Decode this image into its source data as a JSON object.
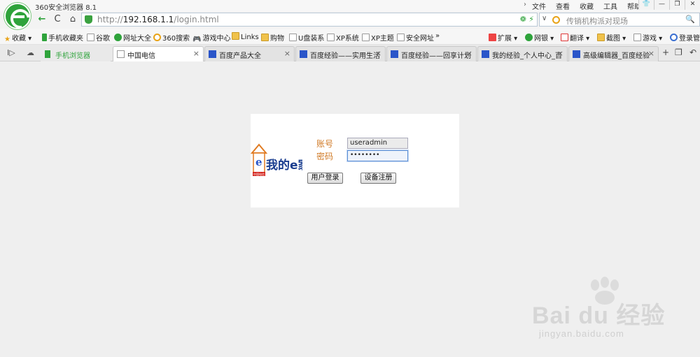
{
  "window": {
    "title": "360安全浏览器 8.1",
    "menu_arrow": "›",
    "menus": [
      "文件",
      "查看",
      "收藏",
      "工具",
      "帮助"
    ],
    "controls": [
      "👕",
      "—",
      "❐",
      "✕"
    ]
  },
  "address": {
    "back": "←",
    "refresh": "C",
    "home": "⌂",
    "url_prefix": "http://",
    "url_host": "192.168.1.1",
    "url_path": "/login.html",
    "url_icons": "❁ ⚡",
    "dropdown": "∨",
    "search_placeholder": "传销机构派对现场",
    "search_icon": "🔍"
  },
  "bookmarks": [
    {
      "label": "收藏",
      "icon": "star-icon",
      "suffix": "▾"
    },
    {
      "label": "手机收藏夹",
      "icon": "phone-icon"
    },
    {
      "label": "谷歌",
      "icon": "page-icon"
    },
    {
      "label": "网址大全",
      "icon": "globe-icon"
    },
    {
      "label": "360搜索",
      "icon": "search-360-icon"
    },
    {
      "label": "游戏中心",
      "icon": "gamepad-icon"
    },
    {
      "label": "Links",
      "icon": "folder-icon"
    },
    {
      "label": "购物",
      "icon": "folder-icon"
    },
    {
      "label": "U盘装系",
      "icon": "page-icon"
    },
    {
      "label": "XP系统",
      "icon": "page-icon"
    },
    {
      "label": "XP主题",
      "icon": "page-icon"
    },
    {
      "label": "安全网址",
      "icon": "page-icon"
    }
  ],
  "bookmarks_more": "»",
  "tools": [
    "扩展 ▾",
    "网银 ▾",
    "翻译 ▾",
    "截图 ▾",
    "游戏 ▾",
    "登录管"
  ],
  "tabs": {
    "left_icons": [
      "I▷",
      "☁"
    ],
    "items": [
      {
        "label": "手机浏览器",
        "icon": "phone-icon",
        "closable": false
      },
      {
        "label": "中国电信",
        "icon": "page-icon",
        "closable": true,
        "active": true
      },
      {
        "label": "百度产品大全",
        "icon": "paw-icon",
        "closable": true
      },
      {
        "label": "百度经验——实用生活",
        "icon": "paw-icon",
        "closable": true
      },
      {
        "label": "百度经验——回享计划",
        "icon": "paw-icon",
        "closable": true
      },
      {
        "label": "我的经验_个人中心_百",
        "icon": "paw-icon",
        "closable": true
      },
      {
        "label": "高级编辑器_百度经验",
        "icon": "paw-icon",
        "closable": true
      }
    ],
    "close_glyph": "×",
    "right_icons": [
      "+",
      "❐",
      "↶"
    ]
  },
  "login": {
    "brand_text": "我的e家",
    "brand_badge": "中国电信",
    "account_label": "账号",
    "account_value": "useradmin",
    "password_label": "密码",
    "password_value": "••••••••",
    "login_button": "用户登录",
    "register_button": "设备注册"
  },
  "watermark": {
    "text": "Bai du 经验",
    "sub": "jingyan.baidu.com"
  },
  "colors": {
    "accent_green": "#2ea33b",
    "label_orange": "#d07a26",
    "baidu_blue": "#2a55c9",
    "ecn_red": "#d4261f"
  }
}
